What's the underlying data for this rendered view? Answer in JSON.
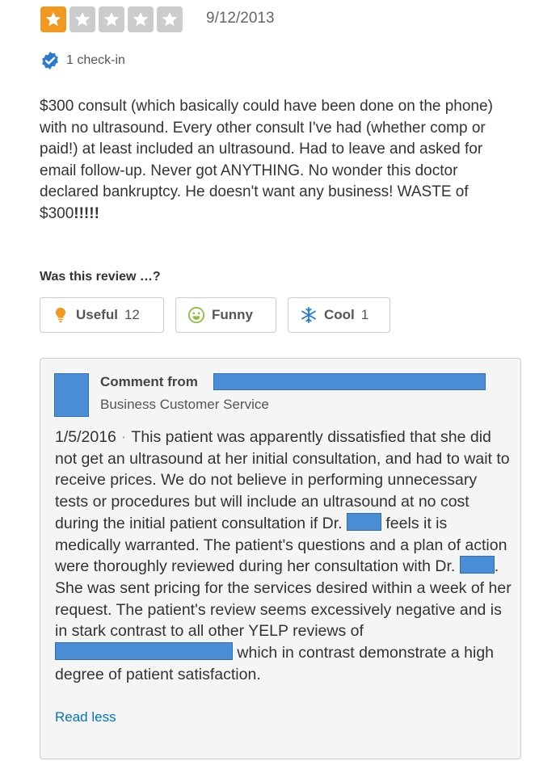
{
  "review": {
    "rating": 1,
    "max_rating": 5,
    "date": "9/12/2013",
    "checkin_text": "1 check-in",
    "text_main": "$300 consult (which basically could have been done on the phone) with no ultrasound. Every other consult I've had (whether comp or paid!) at least included an ultrasound. Had to leave and asked for email follow-up. Never got ANYTHING. No wonder this doctor declared bankruptcy. He doesn't want any business! WASTE of $300",
    "text_exclaim": "!!!!!"
  },
  "votes": {
    "prompt": "Was this review …?",
    "useful": {
      "label": "Useful",
      "count": "12"
    },
    "funny": {
      "label": "Funny",
      "count": ""
    },
    "cool": {
      "label": "Cool",
      "count": "1"
    }
  },
  "owner_comment": {
    "comment_from": "Comment from",
    "role": "Business Customer Service",
    "date": "1/5/2016",
    "separator": "·",
    "body_1": "This patient was apparently dissatisfied that she did not get an ultrasound at her initial consultation, and had to wait to receive prices. We do not believe in performing unnecessary tests or procedures but will include an ultrasound at no cost during the initial patient consultation if Dr. ",
    "body_2": " feels it is medically warranted. The patient's questions and a plan of action were thoroughly reviewed during her consultation with Dr. ",
    "body_3": ". She was sent pricing for the services desired within a week of her request. The patient's review seems excessively negative and is in stark contrast to all other YELP reviews of",
    "body_4": " which in contrast demonstrate a  high degree of patient satisfaction.",
    "read_less": "Read less"
  },
  "colors": {
    "star_on": "#f0991e",
    "star_off": "#cccccc",
    "link": "#0073bb",
    "redaction": "#4a8fd6"
  }
}
